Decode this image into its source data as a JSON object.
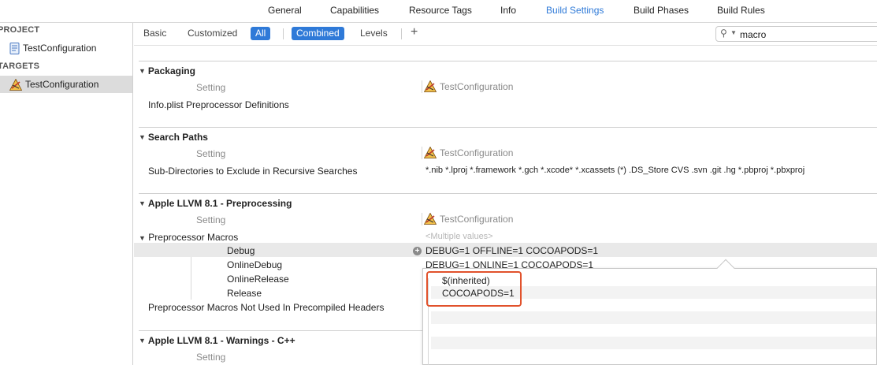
{
  "top_tabs": [
    "General",
    "Capabilities",
    "Resource Tags",
    "Info",
    "Build Settings",
    "Build Phases",
    "Build Rules"
  ],
  "active_tab": "Build Settings",
  "sidebar": {
    "project_header": "PROJECT",
    "project_item": "TestConfiguration",
    "targets_header": "TARGETS",
    "target_item": "TestConfiguration"
  },
  "filter": {
    "basic": "Basic",
    "customized": "Customized",
    "all": "All",
    "combined": "Combined",
    "levels": "Levels",
    "add": "+",
    "search_value": "macro"
  },
  "columns": {
    "setting": "Setting",
    "target": "TestConfiguration"
  },
  "sections": {
    "packaging": {
      "title": "Packaging",
      "rows": [
        {
          "label": "Info.plist Preprocessor Definitions",
          "value": ""
        }
      ]
    },
    "search_paths": {
      "title": "Search Paths",
      "rows": [
        {
          "label": "Sub-Directories to Exclude in Recursive Searches",
          "value": "*.nib *.lproj *.framework *.gch *.xcode* *.xcassets (*) .DS_Store CVS .svn .git .hg *.pbproj *.pbxproj"
        }
      ]
    },
    "preprocessing": {
      "title": "Apple LLVM 8.1 - Preprocessing",
      "macros_label": "Preprocessor Macros",
      "macros_value": "<Multiple values>",
      "configs": [
        {
          "name": "Debug",
          "value": "DEBUG=1  OFFLINE=1 COCOAPODS=1"
        },
        {
          "name": "OnlineDebug",
          "value": "DEBUG=1  ONLINE=1 COCOAPODS=1"
        },
        {
          "name": "OnlineRelease",
          "value": ""
        },
        {
          "name": "Release",
          "value": ""
        }
      ],
      "not_used_label": "Preprocessor Macros Not Used In Precompiled Headers"
    },
    "warnings_cpp": {
      "title": "Apple LLVM 8.1 - Warnings - C++"
    }
  },
  "popover": {
    "lines": [
      "$(inherited)",
      "COCOAPODS=1"
    ]
  },
  "colors": {
    "accent": "#2f7ad8",
    "highlight": "#e1522c"
  }
}
